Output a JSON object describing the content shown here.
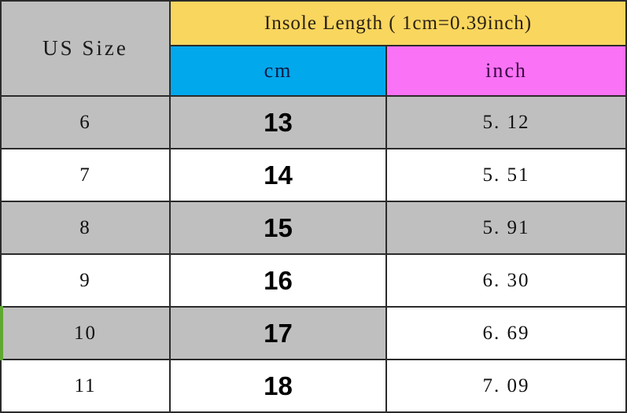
{
  "header": {
    "us_size_label": "US Size",
    "insole_label": "Insole Length ( 1cm=0.39inch)",
    "cm_label": "cm",
    "inch_label": "inch"
  },
  "colors": {
    "insole_header_bg": "#f9d65e",
    "cm_header_bg": "#02a8ec",
    "inch_header_bg": "#fa72f5",
    "row_gray_bg": "#bfbfbf",
    "row_white_bg": "#ffffff",
    "border": "#2b2b2b",
    "selection_marker": "#5fa832"
  },
  "chart_data": {
    "type": "table",
    "title": "Insole Length ( 1cm=0.39inch)",
    "columns": [
      "US Size",
      "cm",
      "inch"
    ],
    "rows": [
      {
        "us_size": "6",
        "cm": "13",
        "inch": "5. 12",
        "shaded": true,
        "inch_shaded": true,
        "marker": false
      },
      {
        "us_size": "7",
        "cm": "14",
        "inch": "5. 51",
        "shaded": false,
        "inch_shaded": false,
        "marker": false
      },
      {
        "us_size": "8",
        "cm": "15",
        "inch": "5. 91",
        "shaded": true,
        "inch_shaded": true,
        "marker": false
      },
      {
        "us_size": "9",
        "cm": "16",
        "inch": "6. 30",
        "shaded": false,
        "inch_shaded": false,
        "marker": false
      },
      {
        "us_size": "10",
        "cm": "17",
        "inch": "6. 69",
        "shaded": true,
        "inch_shaded": false,
        "marker": true
      },
      {
        "us_size": "11",
        "cm": "18",
        "inch": "7. 09",
        "shaded": false,
        "inch_shaded": false,
        "marker": false
      }
    ]
  }
}
